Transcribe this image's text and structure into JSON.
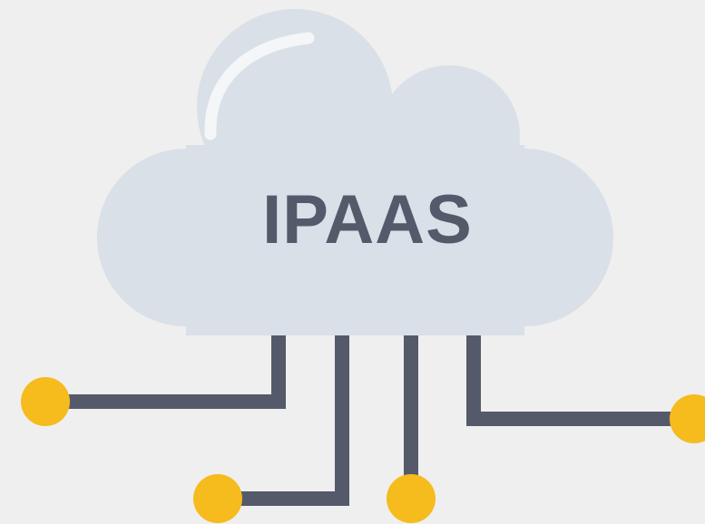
{
  "cloud": {
    "label": "IPAAS"
  },
  "colors": {
    "background": "#efefef",
    "cloud": "#d9e0e8",
    "highlight": "#f4f6f8",
    "text": "#555a6b",
    "connector": "#555a6b",
    "node": "#f6bb1c"
  },
  "icons": [
    "cloud-icon",
    "connector-line",
    "node-dot"
  ]
}
